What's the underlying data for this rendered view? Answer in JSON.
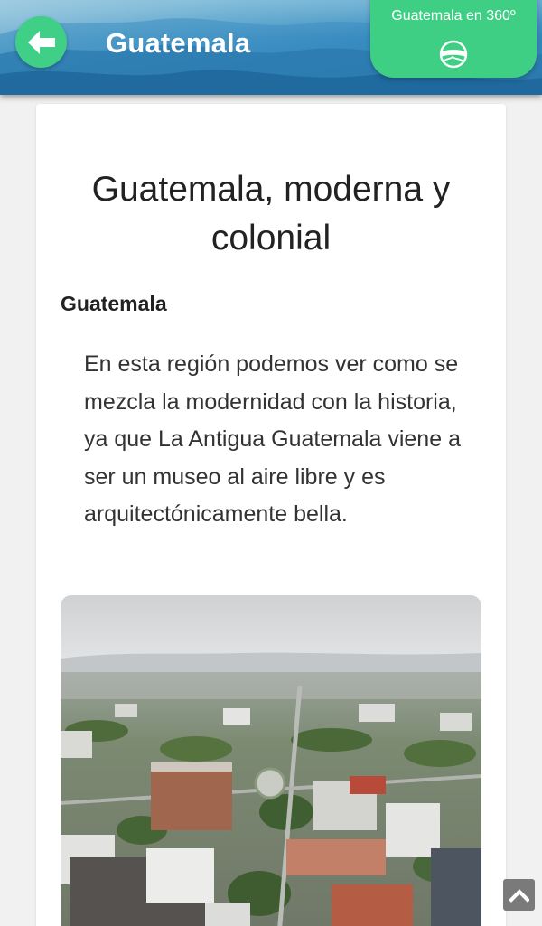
{
  "header": {
    "title": "Guatemala",
    "back_icon": "arrow-left-icon",
    "panel": {
      "label": "Guatemala en 360º",
      "icon": "panorama-360-icon"
    },
    "colors": {
      "accent": "#3ecf85",
      "sky": "#2f86bd"
    }
  },
  "card": {
    "title": "Guatemala, moderna y colonial",
    "subtitle": "Guatemala",
    "body": "En esta región podemos ver como se mezcla la modernidad con la historia, ya que La Antigua Guatemala viene a ser un museo al aire libre y es arquitectónicamente bella."
  },
  "scroll_top": {
    "icon": "chevron-up-icon"
  }
}
